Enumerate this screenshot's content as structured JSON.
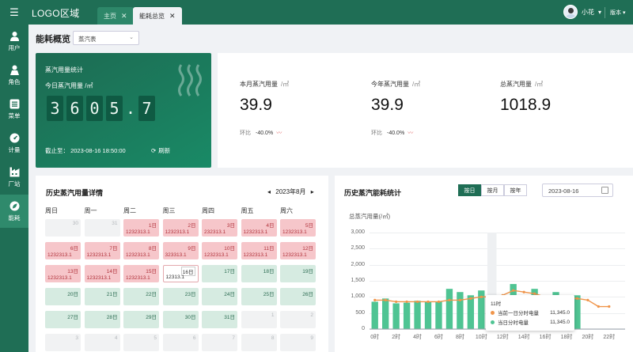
{
  "header": {
    "logo": "LOGO区域",
    "tabs": [
      {
        "label": "主页"
      },
      {
        "label": "能耗总览"
      }
    ],
    "user": "小花",
    "version": "版本"
  },
  "sidebar": {
    "items": [
      {
        "label": "用户",
        "icon": "user-icon"
      },
      {
        "label": "角色",
        "icon": "role-icon"
      },
      {
        "label": "菜单",
        "icon": "menu-list-icon"
      },
      {
        "label": "计量",
        "icon": "gauge-icon"
      },
      {
        "label": "厂站",
        "icon": "factory-icon"
      },
      {
        "label": "能耗",
        "icon": "leaf-icon",
        "active": true
      }
    ]
  },
  "page": {
    "title": "能耗概览",
    "select": "蒸汽表"
  },
  "hero": {
    "title": "蒸汽用量统计",
    "today_label": "今日蒸汽用量",
    "unit": "/㎡",
    "digits": [
      "3",
      "6",
      "0",
      "5",
      ".",
      "7"
    ],
    "cutoff": "截止至：  2023-08-16 18:50:00",
    "refresh": "刷新"
  },
  "stats": [
    {
      "label": "本月蒸汽用量",
      "unit": "/㎡",
      "value": "39.9",
      "cmp_label": "环比",
      "cmp_value": "-40.0%"
    },
    {
      "label": "今年蒸汽用量",
      "unit": "/㎡",
      "value": "39.9",
      "cmp_label": "环比",
      "cmp_value": "-40.0%"
    },
    {
      "label": "总蒸汽用量",
      "unit": "/㎡",
      "value": "1018.9"
    }
  ],
  "calendar": {
    "title": "历史蒸汽用量详情",
    "month": "2023年8月",
    "weekdays": [
      "周日",
      "周一",
      "周二",
      "周三",
      "周四",
      "周五",
      "周六"
    ],
    "weeks": [
      [
        {
          "d": "30",
          "v": "",
          "s": "gray"
        },
        {
          "d": "31",
          "v": "",
          "s": "gray"
        },
        {
          "d": "1日",
          "v": "1232313.1",
          "s": "red"
        },
        {
          "d": "2日",
          "v": "1232313.1",
          "s": "red"
        },
        {
          "d": "3日",
          "v": "232313.1",
          "s": "red"
        },
        {
          "d": "4日",
          "v": "1232313.1",
          "s": "red"
        },
        {
          "d": "5日",
          "v": "1232313.1",
          "s": "red"
        }
      ],
      [
        {
          "d": "6日",
          "v": "1232313.1",
          "s": "red"
        },
        {
          "d": "7日",
          "v": "1232313.1",
          "s": "red"
        },
        {
          "d": "8日",
          "v": "1232313.1",
          "s": "red"
        },
        {
          "d": "9日",
          "v": "323313.1",
          "s": "red"
        },
        {
          "d": "10日",
          "v": "1232313.1",
          "s": "red"
        },
        {
          "d": "11日",
          "v": "1232313.1",
          "s": "red"
        },
        {
          "d": "12日",
          "v": "1232313.1",
          "s": "red"
        }
      ],
      [
        {
          "d": "13日",
          "v": "1232313.1",
          "s": "red"
        },
        {
          "d": "14日",
          "v": "1232313.1",
          "s": "red"
        },
        {
          "d": "15日",
          "v": "1232313.1",
          "s": "red"
        },
        {
          "d": "16日",
          "v": "12313.1",
          "s": "today"
        },
        {
          "d": "17日",
          "v": "",
          "s": "green"
        },
        {
          "d": "18日",
          "v": "",
          "s": "green"
        },
        {
          "d": "19日",
          "v": "",
          "s": "green"
        }
      ],
      [
        {
          "d": "20日",
          "v": "",
          "s": "green"
        },
        {
          "d": "21日",
          "v": "",
          "s": "green"
        },
        {
          "d": "22日",
          "v": "",
          "s": "green"
        },
        {
          "d": "23日",
          "v": "",
          "s": "green"
        },
        {
          "d": "24日",
          "v": "",
          "s": "green"
        },
        {
          "d": "25日",
          "v": "",
          "s": "green"
        },
        {
          "d": "26日",
          "v": "",
          "s": "green"
        }
      ],
      [
        {
          "d": "27日",
          "v": "",
          "s": "green"
        },
        {
          "d": "28日",
          "v": "",
          "s": "green"
        },
        {
          "d": "29日",
          "v": "",
          "s": "green"
        },
        {
          "d": "30日",
          "v": "",
          "s": "green"
        },
        {
          "d": "31日",
          "v": "",
          "s": "green"
        },
        {
          "d": "1",
          "v": "",
          "s": "gray"
        },
        {
          "d": "2",
          "v": "",
          "s": "gray"
        }
      ],
      [
        {
          "d": "3",
          "v": "",
          "s": "gray"
        },
        {
          "d": "4",
          "v": "",
          "s": "gray"
        },
        {
          "d": "5",
          "v": "",
          "s": "gray"
        },
        {
          "d": "6",
          "v": "",
          "s": "gray"
        },
        {
          "d": "7",
          "v": "",
          "s": "gray"
        },
        {
          "d": "8",
          "v": "",
          "s": "gray"
        },
        {
          "d": "9",
          "v": "",
          "s": "gray"
        }
      ]
    ]
  },
  "history": {
    "title": "历史蒸汽能耗统计",
    "segments": [
      "按日",
      "按月",
      "按年"
    ],
    "date": "2023-08-16",
    "tooltip": {
      "title": "11时",
      "rows": [
        {
          "label": "当前一日分时电量",
          "value": "11,345.0",
          "color": "#f0954a"
        },
        {
          "label": "当日分时电量",
          "value": "11,345.0",
          "color": "#4fc493"
        }
      ]
    }
  },
  "chart_data": {
    "type": "bar",
    "ylabel": "总蒸汽用量(/㎡)",
    "ylim": [
      0,
      3000
    ],
    "yticks": [
      "3,000",
      "2,500",
      "2,000",
      "1,500",
      "1,000",
      "500",
      "0"
    ],
    "xticks": [
      "0时",
      "2时",
      "4时",
      "6时",
      "8时",
      "10时",
      "12时",
      "14时",
      "16时",
      "18时",
      "20时",
      "22时"
    ],
    "categories": [
      "0时",
      "1时",
      "2时",
      "3时",
      "4时",
      "5时",
      "6时",
      "7时",
      "8时",
      "9时",
      "10时",
      "11时",
      "12时",
      "13时",
      "14时",
      "15时",
      "16时",
      "17时",
      "18时",
      "19时",
      "20时",
      "21时",
      "22时",
      "23时"
    ],
    "series": [
      {
        "name": "当日分时电量",
        "type": "bar",
        "color": "#4fc493",
        "values": [
          850,
          950,
          800,
          820,
          880,
          840,
          850,
          1250,
          1150,
          1050,
          1200,
          800,
          650,
          1400,
          1000,
          1250,
          1000,
          1150,
          1050,
          1050,
          null,
          null,
          null,
          null
        ]
      },
      {
        "name": "当前一日分时电量",
        "type": "line",
        "color": "#f0954a",
        "values": [
          900,
          900,
          850,
          850,
          850,
          850,
          850,
          900,
          900,
          950,
          1000,
          1000,
          1050,
          1200,
          1150,
          1100,
          1000,
          1000,
          950,
          950,
          900,
          700,
          700,
          null
        ]
      }
    ]
  }
}
